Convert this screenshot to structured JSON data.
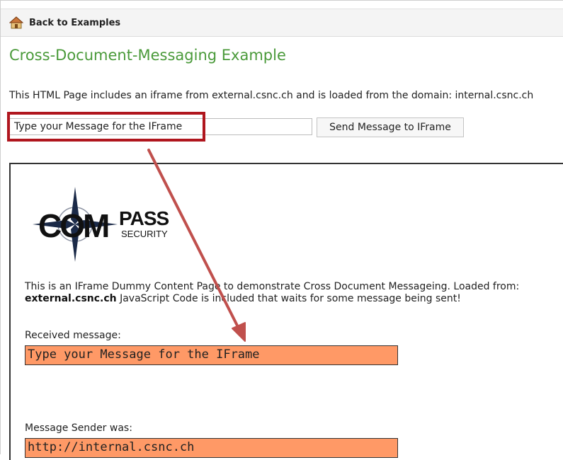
{
  "topbar": {
    "back_label": "Back to Examples"
  },
  "page": {
    "title": "Cross-Document-Messaging Example",
    "intro": "This HTML Page includes an iframe from external.csnc.ch and is loaded from the domain: internal.csnc.ch"
  },
  "form": {
    "input_value": "Type your Message for the IFrame",
    "send_label": "Send Message to IFrame"
  },
  "iframe": {
    "logo_text_main": "COMPASS",
    "logo_text_sub": "SECURITY",
    "desc_part1": "This is an IFrame Dummy Content Page to demonstrate Cross Document Messageing. Loaded from: ",
    "desc_bold": "external.csnc.ch",
    "desc_part2": " JavaScript Code is included that waits for some message being sent!",
    "received_label": "Received message:",
    "received_value": "Type your Message for the IFrame",
    "sender_label": "Message Sender was:",
    "sender_value": "http://internal.csnc.ch"
  },
  "colors": {
    "title_green": "#4a9a3a",
    "highlight_red": "#b0161e",
    "output_orange": "#ff9966",
    "arrow": "#c0504d"
  },
  "icons": {
    "back": "home-icon"
  }
}
